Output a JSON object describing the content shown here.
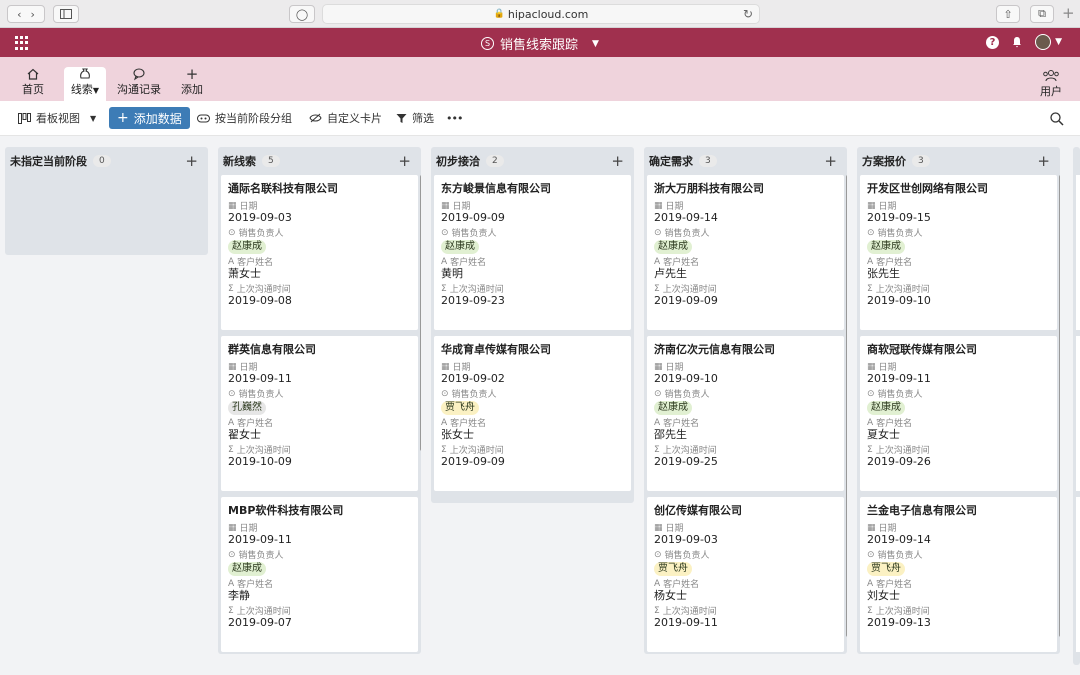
{
  "browser": {
    "url": "hipacloud.com"
  },
  "app": {
    "title": "销售线索跟踪",
    "title_badge": "S"
  },
  "nav": {
    "items": [
      {
        "label": "首页",
        "icon": "home-icon"
      },
      {
        "label": "线索",
        "icon": "money-bag-icon",
        "active": true
      },
      {
        "label": "沟通记录",
        "icon": "chat-icon"
      },
      {
        "label": "添加",
        "icon": "plus-icon"
      }
    ],
    "users_label": "用户"
  },
  "toolbar": {
    "view_label": "看板视图",
    "add_label": "添加数据",
    "group_label": "按当前阶段分组",
    "custom_card_label": "自定义卡片",
    "filter_label": "筛选",
    "more_label": "•••"
  },
  "fields": {
    "date": "日期",
    "owner": "销售负责人",
    "customer": "客户姓名",
    "last_contact": "上次沟通时间"
  },
  "columns": [
    {
      "title": "未指定当前阶段",
      "count": "0",
      "cards": []
    },
    {
      "title": "新线索",
      "count": "5",
      "cards": [
        {
          "company": "通际名联科技有限公司",
          "date": "2019-09-03",
          "owner": "赵康成",
          "customer": "萧女士",
          "last_contact": "2019-09-08"
        },
        {
          "company": "群英信息有限公司",
          "date": "2019-09-11",
          "owner": "孔巍然",
          "customer": "翟女士",
          "last_contact": "2019-10-09"
        },
        {
          "company": "MBP软件科技有限公司",
          "date": "2019-09-11",
          "owner": "赵康成",
          "customer": "李静",
          "last_contact": "2019-09-07"
        }
      ]
    },
    {
      "title": "初步接洽",
      "count": "2",
      "cards": [
        {
          "company": "东方峻景信息有限公司",
          "date": "2019-09-09",
          "owner": "赵康成",
          "customer": "黄明",
          "last_contact": "2019-09-23"
        },
        {
          "company": "华成育卓传媒有限公司",
          "date": "2019-09-02",
          "owner": "贾飞舟",
          "customer": "张女士",
          "last_contact": "2019-09-09"
        }
      ]
    },
    {
      "title": "确定需求",
      "count": "3",
      "cards": [
        {
          "company": "浙大万朋科技有限公司",
          "date": "2019-09-14",
          "owner": "赵康成",
          "customer": "卢先生",
          "last_contact": "2019-09-09"
        },
        {
          "company": "济南亿次元信息有限公司",
          "date": "2019-09-10",
          "owner": "赵康成",
          "customer": "邵先生",
          "last_contact": "2019-09-25"
        },
        {
          "company": "创亿传媒有限公司",
          "date": "2019-09-03",
          "owner": "贾飞舟",
          "customer": "杨女士",
          "last_contact": "2019-09-11"
        }
      ]
    },
    {
      "title": "方案报价",
      "count": "3",
      "cards": [
        {
          "company": "开发区世创网络有限公司",
          "date": "2019-09-15",
          "owner": "赵康成",
          "customer": "张先生",
          "last_contact": "2019-09-10"
        },
        {
          "company": "商软冠联传媒有限公司",
          "date": "2019-09-11",
          "owner": "赵康成",
          "customer": "夏女士",
          "last_contact": "2019-09-26"
        },
        {
          "company": "兰金电子信息有限公司",
          "date": "2019-09-14",
          "owner": "贾飞舟",
          "customer": "刘女士",
          "last_contact": "2019-09-13"
        }
      ]
    }
  ]
}
